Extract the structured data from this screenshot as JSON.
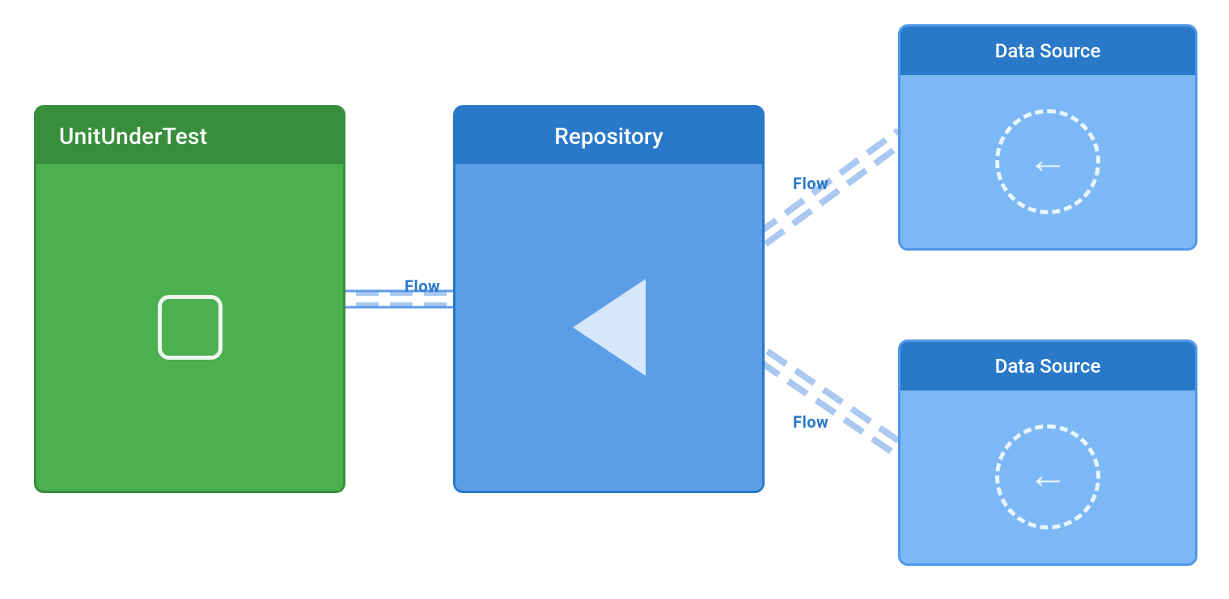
{
  "diagram": {
    "background": "#ffffff",
    "unitBlock": {
      "title": "UnitUnderTest",
      "headerBg": "#388e3c",
      "bodyBg": "#4caf50"
    },
    "repoBlock": {
      "title": "Repository",
      "headerBg": "#2979c8",
      "bodyBg": "#5c9ee8"
    },
    "dataSourceTop": {
      "title": "Data Source",
      "headerBg": "#2979c8",
      "bodyBg": "#7cb8f5"
    },
    "dataSourceBottom": {
      "title": "Data Source",
      "headerBg": "#2979c8",
      "bodyBg": "#7cb8f5"
    },
    "flowLabels": {
      "main": "Flow",
      "top": "Flow",
      "bottom": "Flow"
    }
  }
}
